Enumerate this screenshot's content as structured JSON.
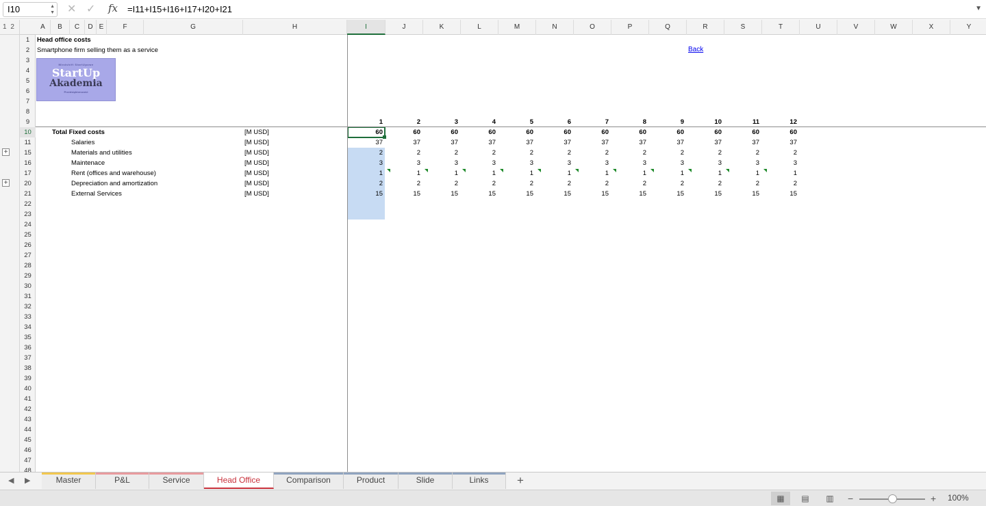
{
  "formula_bar": {
    "name_box": "I10",
    "formula": "=I11+I15+I16+I17+I20+I21",
    "cancel_icon": "x-icon",
    "confirm_icon": "check-icon",
    "fx_label": "fx"
  },
  "outline_levels": [
    "1",
    "2"
  ],
  "columns": [
    "A",
    "B",
    "C",
    "D",
    "E",
    "F",
    "G",
    "H",
    "I",
    "J",
    "K",
    "L",
    "M",
    "N",
    "O",
    "P",
    "Q",
    "R",
    "S",
    "T",
    "U",
    "V",
    "W",
    "X",
    "Y"
  ],
  "selected_column": "I",
  "rows": [
    "1",
    "2",
    "3",
    "4",
    "5",
    "6",
    "7",
    "8",
    "9",
    "10",
    "11",
    "15",
    "16",
    "17",
    "20",
    "21",
    "22",
    "23",
    "24",
    "25",
    "26",
    "27",
    "28",
    "29",
    "30",
    "31",
    "32",
    "33",
    "34",
    "35",
    "36",
    "37",
    "38",
    "39",
    "40",
    "41",
    "42",
    "43",
    "44",
    "45",
    "46",
    "47",
    "48"
  ],
  "selected_row": "10",
  "sheet": {
    "title": "Head office costs",
    "subtitle": "Smartphone firm selling them as a service",
    "back_link": "Back",
    "logo": {
      "top_text": "Mindshift StartUpowe",
      "line1": "StartUp",
      "line2": "Akademia",
      "bottom_text": "Przedsiębiorczość"
    },
    "periods": [
      "1",
      "2",
      "3",
      "4",
      "5",
      "6",
      "7",
      "8",
      "9",
      "10",
      "11",
      "12"
    ],
    "line_items": [
      {
        "label": "Total Fixed costs",
        "unit": "[M USD]",
        "bold": true,
        "values": [
          "60",
          "60",
          "60",
          "60",
          "60",
          "60",
          "60",
          "60",
          "60",
          "60",
          "60",
          "60"
        ]
      },
      {
        "label": "Salaries",
        "unit": "[M USD]",
        "bold": false,
        "values": [
          "37",
          "37",
          "37",
          "37",
          "37",
          "37",
          "37",
          "37",
          "37",
          "37",
          "37",
          "37"
        ]
      },
      {
        "label": "Materials and utilities",
        "unit": "[M USD]",
        "bold": false,
        "values": [
          "2",
          "2",
          "2",
          "2",
          "2",
          "2",
          "2",
          "2",
          "2",
          "2",
          "2",
          "2"
        ]
      },
      {
        "label": "Maintenace",
        "unit": "[M USD]",
        "bold": false,
        "values": [
          "3",
          "3",
          "3",
          "3",
          "3",
          "3",
          "3",
          "3",
          "3",
          "3",
          "3",
          "3"
        ]
      },
      {
        "label": "Rent (offices and warehouse)",
        "unit": "[M USD]",
        "bold": false,
        "values": [
          "1",
          "1",
          "1",
          "1",
          "1",
          "1",
          "1",
          "1",
          "1",
          "1",
          "1",
          "1"
        ]
      },
      {
        "label": "Depreciation and amortization",
        "unit": "[M USD]",
        "bold": false,
        "values": [
          "2",
          "2",
          "2",
          "2",
          "2",
          "2",
          "2",
          "2",
          "2",
          "2",
          "2",
          "2"
        ]
      },
      {
        "label": "External Services",
        "unit": "[M USD]",
        "bold": false,
        "values": [
          "15",
          "15",
          "15",
          "15",
          "15",
          "15",
          "15",
          "15",
          "15",
          "15",
          "15",
          "15"
        ]
      }
    ]
  },
  "tabs": [
    {
      "label": "Master",
      "color": "#f2c74e",
      "active": false
    },
    {
      "label": "P&L",
      "color": "#e89a9e",
      "active": false
    },
    {
      "label": "Service",
      "color": "#e89a9e",
      "active": false
    },
    {
      "label": "Head Office",
      "color": "#e89a9e",
      "active": true
    },
    {
      "label": "Comparison",
      "color": "#8fa3bf",
      "active": false
    },
    {
      "label": "Product",
      "color": "#8fa3bf",
      "active": false
    },
    {
      "label": "Slide",
      "color": "#8fa3bf",
      "active": false
    },
    {
      "label": "Links",
      "color": "#8fa3bf",
      "active": false
    }
  ],
  "add_sheet_label": "+",
  "status_bar": {
    "zoom_level": "100%",
    "zoom_minus": "−",
    "zoom_plus": "+"
  },
  "colors": {
    "accent": "#1e6e3a",
    "selection": "#c7dbf3",
    "active_tab": "#c8313b",
    "link": "#0000ee"
  }
}
